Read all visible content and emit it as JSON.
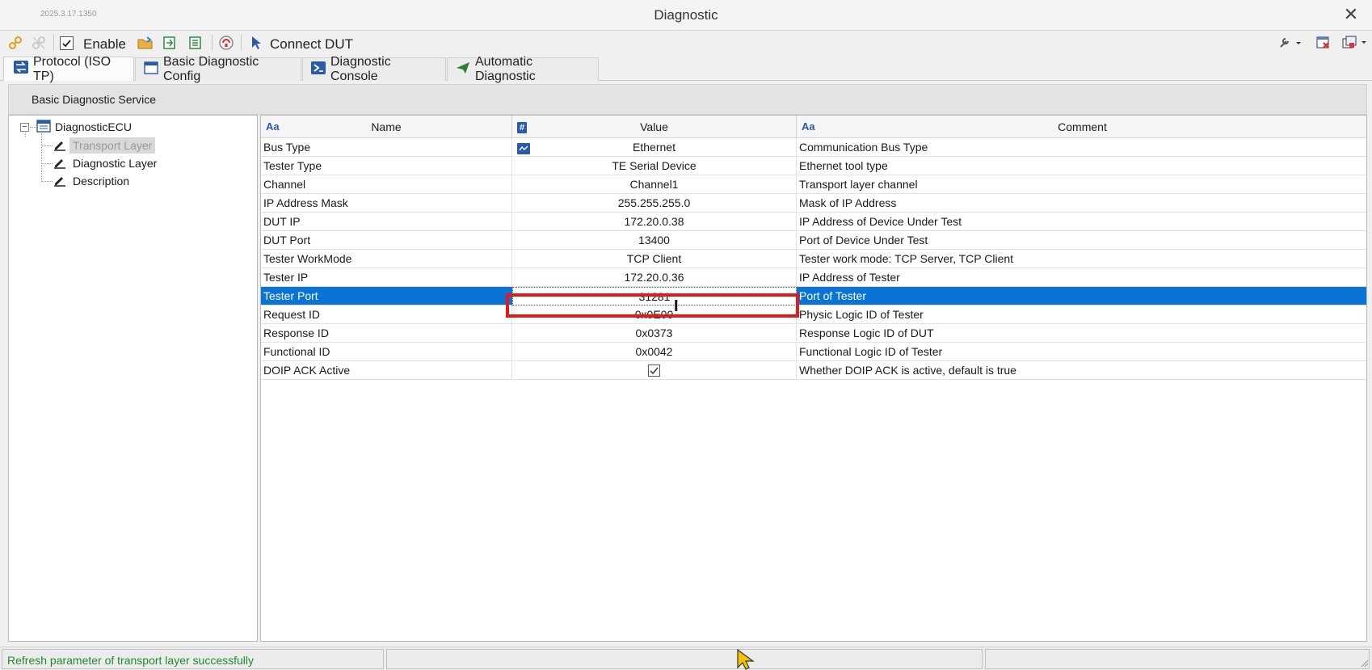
{
  "window": {
    "version": "2025.3.17.1350",
    "title": "Diagnostic"
  },
  "toolbar": {
    "enable_label": "Enable",
    "connect_label": "Connect DUT"
  },
  "tabs": [
    {
      "label": "Protocol (ISO TP)",
      "icon": "swap-icon"
    },
    {
      "label": "Basic Diagnostic Config",
      "icon": "window-icon"
    },
    {
      "label": "Diagnostic Console",
      "icon": "console-icon"
    },
    {
      "label": "Automatic Diagnostic",
      "icon": "send-icon"
    }
  ],
  "section": {
    "title": "Basic Diagnostic Service"
  },
  "tree": {
    "root": "DiagnosticECU",
    "items": [
      "Transport Layer",
      "Diagnostic Layer",
      "Description"
    ],
    "selected": "Transport Layer"
  },
  "grid": {
    "columns": [
      {
        "label": "Name",
        "icon_text": "Aa"
      },
      {
        "label": "Value",
        "icon_text": "#"
      },
      {
        "label": "Comment",
        "icon_text": "Aa"
      }
    ],
    "rows": [
      {
        "name": "Bus Type",
        "value": "Ethernet",
        "comment": "Communication Bus Type"
      },
      {
        "name": "Tester Type",
        "value": "TE Serial Device",
        "comment": "Ethernet tool type"
      },
      {
        "name": "Channel",
        "value": "Channel1",
        "comment": "Transport layer channel"
      },
      {
        "name": "IP Address Mask",
        "value": "255.255.255.0",
        "comment": "Mask of IP Address"
      },
      {
        "name": "DUT IP",
        "value": "172.20.0.38",
        "comment": "IP Address of Device Under Test"
      },
      {
        "name": "DUT Port",
        "value": "13400",
        "comment": "Port of Device Under Test"
      },
      {
        "name": "Tester WorkMode",
        "value": "TCP Client",
        "comment": "Tester work mode: TCP Server, TCP Client"
      },
      {
        "name": "Tester IP",
        "value": "172.20.0.36",
        "comment": "IP Address of Tester"
      },
      {
        "name": "Tester Port",
        "value": "31281",
        "comment": "Port of Tester"
      },
      {
        "name": "Request ID",
        "value": "0x0E00",
        "comment": "Physic Logic ID of Tester"
      },
      {
        "name": "Response ID",
        "value": "0x0373",
        "comment": "Response Logic ID of DUT"
      },
      {
        "name": "Functional ID",
        "value": "0x0042",
        "comment": "Functional Logic ID of Tester"
      },
      {
        "name": "DOIP ACK Active",
        "value": "",
        "checked": true,
        "comment": "Whether DOIP ACK is active, default is true"
      }
    ],
    "selected_row": "Tester Port"
  },
  "status": {
    "message": "Refresh parameter of transport layer successfully"
  },
  "colors": {
    "selection": "#0a74d6",
    "highlight_box": "#e21a1a",
    "status_text": "#1e8a2e"
  }
}
